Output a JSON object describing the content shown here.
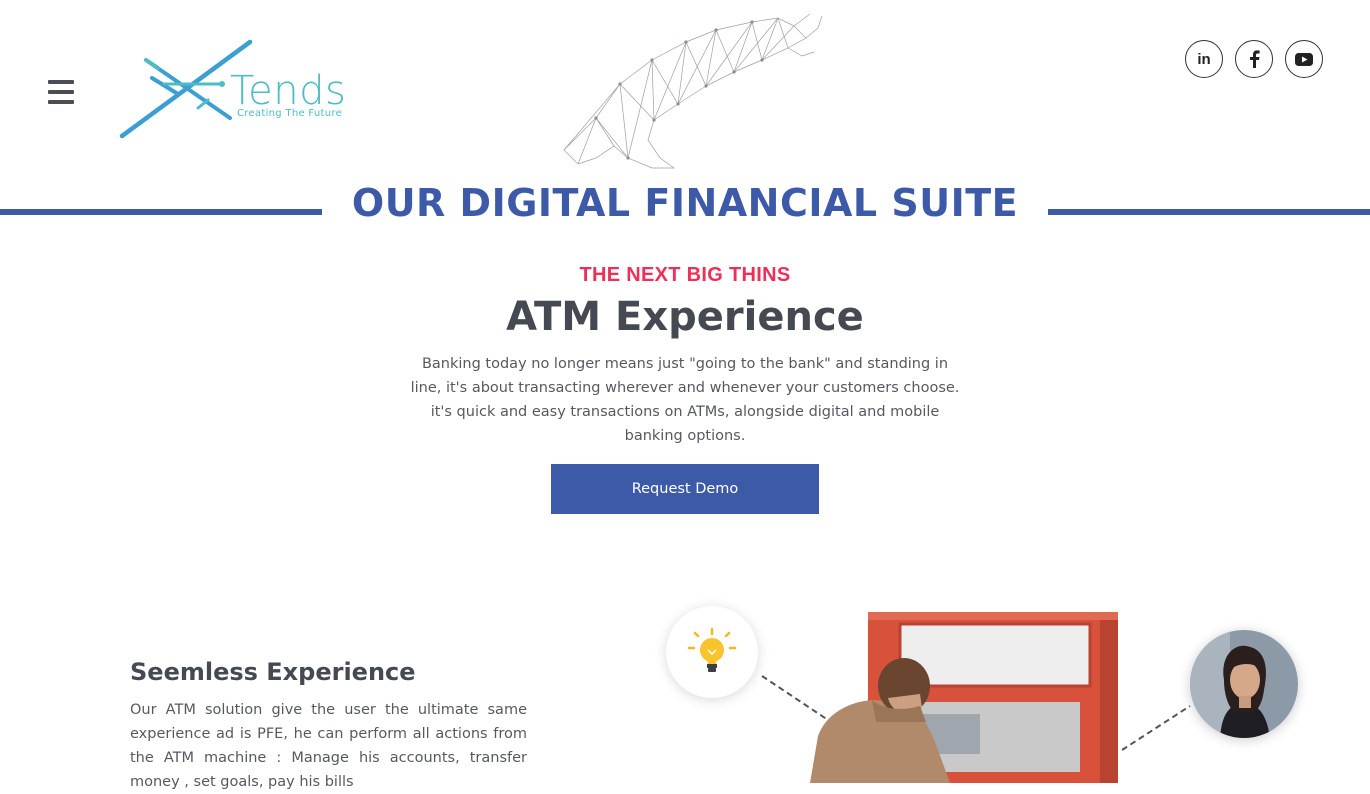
{
  "header": {
    "menu_icon": "hamburger-icon",
    "logo": {
      "word": "Tends",
      "tagline": "Creating The Future"
    },
    "social": [
      {
        "name": "linkedin",
        "label": "in",
        "icon": "linkedin-icon"
      },
      {
        "name": "facebook",
        "icon": "facebook-icon"
      },
      {
        "name": "youtube",
        "icon": "youtube-icon"
      }
    ]
  },
  "suite": {
    "title": "OUR DIGITAL FINANCIAL SUITE"
  },
  "hero": {
    "kicker": "THE NEXT BIG THINS",
    "headline": "ATM Experience",
    "intro": "Banking today no longer means just \"going to the bank\" and standing in line, it's about transacting wherever and whenever your customers choose. it's quick and easy transactions on ATMs, alongside digital and mobile banking options.",
    "cta_label": "Request Demo"
  },
  "feature": {
    "title": "Seemless Experience",
    "body": "Our ATM solution give the user the ultimate same experience ad is PFE, he can perform all actions from the ATM machine : Manage his accounts, transfer money , set goals, pay his bills"
  },
  "colors": {
    "brand_blue": "#3d5aa9",
    "accent_pink": "#ee2f57",
    "logo_teal": "#4fbcc4",
    "atm_red": "#d8513a"
  }
}
